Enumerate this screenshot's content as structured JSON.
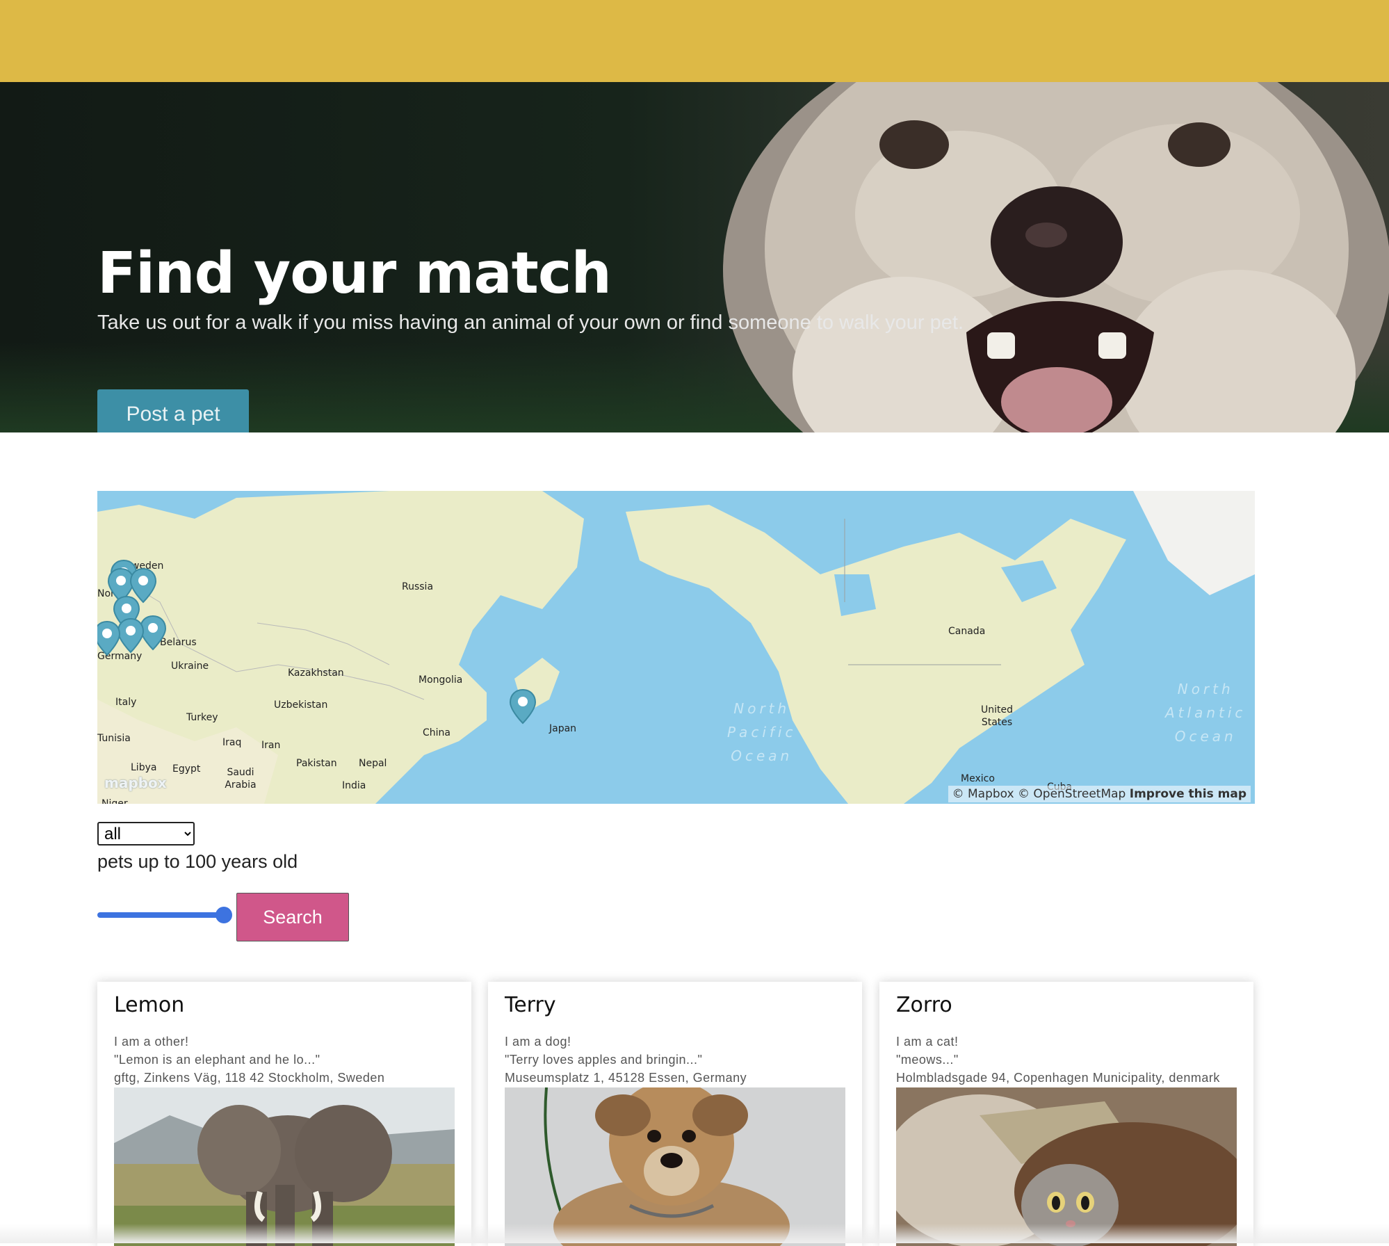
{
  "hero": {
    "title": "Find your match",
    "subtitle": "Take us out for a walk if you miss having an animal of your own or find someone to walk your pet.",
    "post_button": "Post a pet"
  },
  "map": {
    "labels": {
      "sweden": "Sweden",
      "norway": "Nor",
      "russia": "Russia",
      "belarus": "Belarus",
      "germany": "Germany",
      "ukraine": "Ukraine",
      "kazakhstan": "Kazakhstan",
      "mongolia": "Mongolia",
      "italy": "Italy",
      "uzbekistan": "Uzbekistan",
      "turkey": "Turkey",
      "tunisia": "Tunisia",
      "iraq": "Iraq",
      "iran": "Iran",
      "china": "China",
      "japan": "Japan",
      "libya": "Libya",
      "egypt": "Egypt",
      "pakistan": "Pakistan",
      "nepal": "Nepal",
      "saudi_arabia": "Saudi Arabia",
      "india": "India",
      "niger": "Niger",
      "canada": "Canada",
      "united_states": "United States",
      "mexico": "Mexico",
      "cuba": "Cuba"
    },
    "ocean_north_pacific": [
      "North",
      "Pacific",
      "Ocean"
    ],
    "ocean_north_atlantic": [
      "North",
      "Atlantic",
      "Ocean"
    ],
    "logo": "mapbox",
    "attribution_mapbox": "© Mapbox",
    "attribution_osm": "© OpenStreetMap",
    "attribution_improve": "Improve this map"
  },
  "filters": {
    "type_selected": "all",
    "age_text": "pets up to 100 years old",
    "age_max": 100,
    "slider_level": 1.0,
    "search_button": "Search"
  },
  "pets": [
    {
      "name": "Lemon",
      "type": "I am a other!",
      "description": "\"Lemon is an elephant and he lo...\"",
      "address": "gftg, Zinkens Väg, 118 42 Stockholm, Sweden"
    },
    {
      "name": "Terry",
      "type": "I am a dog!",
      "description": "\"Terry loves apples and bringin...\"",
      "address": "Museumsplatz 1, 45128 Essen, Germany"
    },
    {
      "name": "Zorro",
      "type": "I am a cat!",
      "description": "\"meows...\"",
      "address": "Holmbladsgade 94, Copenhagen Municipality, denmark"
    }
  ],
  "colors": {
    "topbar": "#ddb946",
    "post_button": "#3d8fa6",
    "search_button": "#d0578a",
    "slider": "#3d73e0",
    "map_water": "#8ccbea",
    "map_land": "#eaecc8",
    "marker": "#5aaac3"
  }
}
